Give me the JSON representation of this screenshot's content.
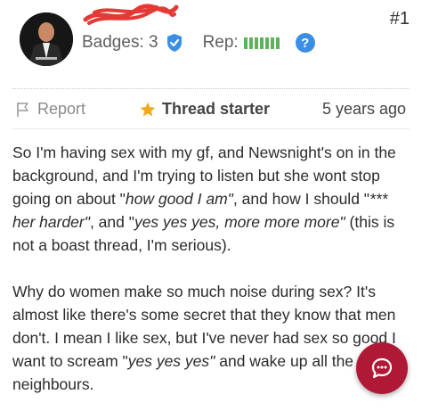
{
  "post": {
    "number": "#1",
    "badges_label": "Badges: 3",
    "rep_label": "Rep:",
    "rep_level": 7,
    "help": "?",
    "report_label": "Report",
    "thread_starter_label": "Thread starter",
    "time_ago": "5 years ago"
  },
  "body": {
    "p1": [
      {
        "t": "So I'm having sex with my gf, and Newsnight's on in the background, and I'm trying to listen but she wont stop going on about \"",
        "i": false
      },
      {
        "t": "how good I am\"",
        "i": true
      },
      {
        "t": ", and how I should \"",
        "i": false
      },
      {
        "t": "*** her harder\"",
        "i": true
      },
      {
        "t": ", and \"",
        "i": false
      },
      {
        "t": "yes yes yes, more more more\"",
        "i": true
      },
      {
        "t": " (this is not a boast thread, I'm serious).",
        "i": false
      }
    ],
    "p2": [
      {
        "t": "Why do women make so much noise during sex? It's almost like there's some secret that they know that men don't. I mean I like sex, but I've never had sex so good I want to scream \"",
        "i": false
      },
      {
        "t": "yes yes yes\"",
        "i": true
      },
      {
        "t": " and wake up all the neighbours.",
        "i": false
      }
    ]
  },
  "icons": {
    "badge": "shield-check-icon",
    "report": "flag-icon",
    "thread_starter": "star-icon",
    "reply": "chat-bubble-icon"
  },
  "colors": {
    "accent_blue": "#3a8ee6",
    "rep_green": "#5ab55a",
    "star": "#f2a91e",
    "fab": "#b01935",
    "redaction": "#e53935"
  }
}
